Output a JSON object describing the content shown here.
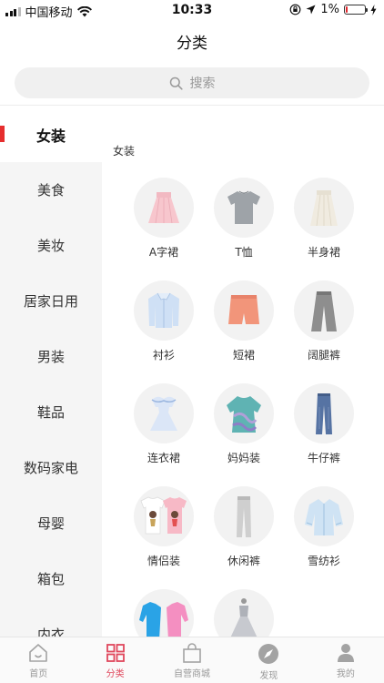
{
  "status_bar": {
    "carrier": "中国移动",
    "time": "10:33",
    "battery": "1%"
  },
  "header": {
    "title": "分类"
  },
  "search": {
    "placeholder": "搜索"
  },
  "sidebar": {
    "items": [
      {
        "label": "女装",
        "active": true
      },
      {
        "label": "美食"
      },
      {
        "label": "美妆"
      },
      {
        "label": "居家日用"
      },
      {
        "label": "男装"
      },
      {
        "label": "鞋品"
      },
      {
        "label": "数码家电"
      },
      {
        "label": "母婴"
      },
      {
        "label": "箱包"
      },
      {
        "label": "内衣"
      }
    ]
  },
  "main": {
    "section_title": "女装",
    "categories": [
      {
        "label": "A字裙",
        "icon": "a-line-skirt-icon"
      },
      {
        "label": "T恤",
        "icon": "tshirt-icon"
      },
      {
        "label": "半身裙",
        "icon": "half-skirt-icon"
      },
      {
        "label": "衬衫",
        "icon": "shirt-icon"
      },
      {
        "label": "短裙",
        "icon": "short-skirt-icon"
      },
      {
        "label": "阔腿裤",
        "icon": "wide-leg-pants-icon"
      },
      {
        "label": "连衣裙",
        "icon": "dress-icon"
      },
      {
        "label": "妈妈装",
        "icon": "mom-wear-icon"
      },
      {
        "label": "牛仔裤",
        "icon": "jeans-icon"
      },
      {
        "label": "情侣装",
        "icon": "couple-wear-icon"
      },
      {
        "label": "休闲裤",
        "icon": "casual-pants-icon"
      },
      {
        "label": "雪纺衫",
        "icon": "chiffon-shirt-icon"
      },
      {
        "label": "",
        "icon": "jacket-icon"
      },
      {
        "label": "",
        "icon": "gown-icon"
      }
    ]
  },
  "tabbar": {
    "tabs": [
      {
        "label": "首页",
        "icon": "home-icon"
      },
      {
        "label": "分类",
        "icon": "category-grid-icon",
        "active": true
      },
      {
        "label": "自营商城",
        "icon": "shopping-bag-icon"
      },
      {
        "label": "发现",
        "icon": "compass-icon"
      },
      {
        "label": "我的",
        "icon": "user-icon"
      }
    ]
  },
  "colors": {
    "accent": "#e0475c",
    "sidebar_indicator": "#e62e2e",
    "sidebar_bg": "#f5f5f5",
    "search_bg": "#f0f0f0"
  }
}
